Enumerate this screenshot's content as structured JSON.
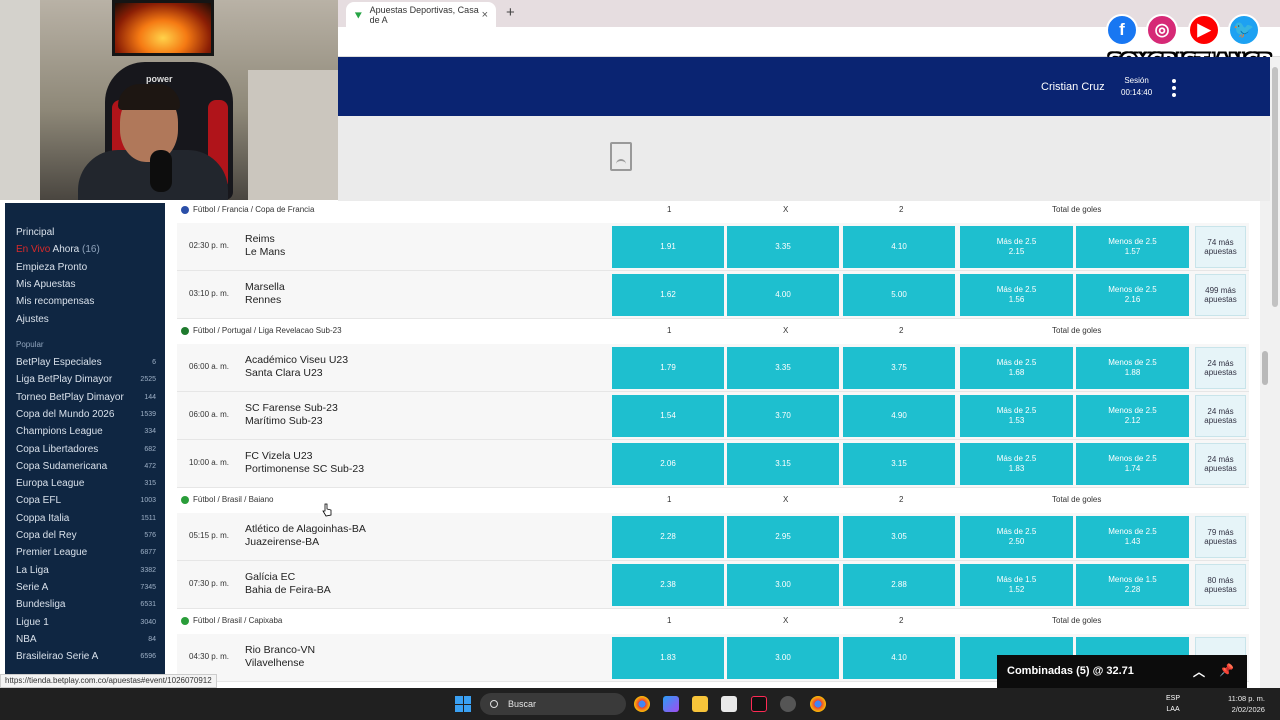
{
  "browser": {
    "tab_title": "Apuestas Deportivas, Casa de A",
    "tab_close": "×",
    "new_tab": "+"
  },
  "overlay": {
    "brand": "SOYCRISTIANCR",
    "social": [
      "f",
      "◎",
      "▶",
      "🐦"
    ],
    "chair_logo": "power"
  },
  "header": {
    "user_name": "Cristian Cruz",
    "session_label": "Sesión",
    "session_time": "00:14:40"
  },
  "sidebar": {
    "nav": [
      {
        "label": "Principal"
      },
      {
        "live": "En Vivo",
        "label": " Ahora",
        "count": " (16)"
      },
      {
        "label": "Empieza Pronto"
      },
      {
        "label": "Mis Apuestas"
      },
      {
        "label": "Mis recompensas"
      },
      {
        "label": "Ajustes"
      }
    ],
    "popular_label": "Popular",
    "leagues": [
      {
        "name": "BetPlay Especiales",
        "count": "6"
      },
      {
        "name": "Liga BetPlay Dimayor",
        "count": "2525"
      },
      {
        "name": "Torneo BetPlay Dimayor",
        "count": "144"
      },
      {
        "name": "Copa del Mundo 2026",
        "count": "1539"
      },
      {
        "name": "Champions League",
        "count": "334"
      },
      {
        "name": "Copa Libertadores",
        "count": "682"
      },
      {
        "name": "Copa Sudamericana",
        "count": "472"
      },
      {
        "name": "Europa League",
        "count": "315"
      },
      {
        "name": "Copa EFL",
        "count": "1003"
      },
      {
        "name": "Coppa Italia",
        "count": "1511"
      },
      {
        "name": "Copa del Rey",
        "count": "576"
      },
      {
        "name": "Premier League",
        "count": "6877"
      },
      {
        "name": "La Liga",
        "count": "3382"
      },
      {
        "name": "Serie A",
        "count": "7345"
      },
      {
        "name": "Bundesliga",
        "count": "6531"
      },
      {
        "name": "Ligue 1",
        "count": "3040"
      },
      {
        "name": "NBA",
        "count": "84"
      },
      {
        "name": "Brasileirao Serie A",
        "count": "6596"
      }
    ]
  },
  "columns": {
    "one": "1",
    "x": "X",
    "two": "2",
    "total": "Total de goles"
  },
  "groups": [
    {
      "path": "Fútbol / Francia / Copa de Francia",
      "flag_color": "#2b4fa8",
      "events": [
        {
          "time": "02:30 p. m.",
          "home": "Reims",
          "away": "Le Mans",
          "o1": "1.91",
          "ox": "3.35",
          "o2": "4.10",
          "over_label": "Más de  2.5",
          "over": "2.15",
          "under_label": "Menos de  2.5",
          "under": "1.57",
          "more": "74 más apuestas"
        },
        {
          "time": "03:10 p. m.",
          "home": "Marsella",
          "away": "Rennes",
          "o1": "1.62",
          "ox": "4.00",
          "o2": "5.00",
          "over_label": "Más de  2.5",
          "over": "1.56",
          "under_label": "Menos de  2.5",
          "under": "2.16",
          "more": "499 más apuestas"
        }
      ]
    },
    {
      "path": "Fútbol / Portugal / Liga Revelacao Sub-23",
      "flag_color": "#1f7a2e",
      "events": [
        {
          "time": "06:00 a. m.",
          "home": "Académico Viseu U23",
          "away": "Santa Clara U23",
          "o1": "1.79",
          "ox": "3.35",
          "o2": "3.75",
          "over_label": "Más de  2.5",
          "over": "1.68",
          "under_label": "Menos de  2.5",
          "under": "1.88",
          "more": "24 más apuestas"
        },
        {
          "time": "06:00 a. m.",
          "home": "SC Farense Sub-23",
          "away": "Marítimo Sub-23",
          "o1": "1.54",
          "ox": "3.70",
          "o2": "4.90",
          "over_label": "Más de  2.5",
          "over": "1.53",
          "under_label": "Menos de  2.5",
          "under": "2.12",
          "more": "24 más apuestas"
        },
        {
          "time": "10:00 a. m.",
          "home": "FC Vizela U23",
          "away": "Portimonense SC Sub-23",
          "o1": "2.06",
          "ox": "3.15",
          "o2": "3.15",
          "over_label": "Más de  2.5",
          "over": "1.83",
          "under_label": "Menos de  2.5",
          "under": "1.74",
          "more": "24 más apuestas"
        }
      ]
    },
    {
      "path": "Fútbol / Brasil / Baiano",
      "flag_color": "#2a9d3a",
      "events": [
        {
          "time": "05:15 p. m.",
          "home": "Atlético de Alagoinhas-BA",
          "away": "Juazeirense-BA",
          "o1": "2.28",
          "ox": "2.95",
          "o2": "3.05",
          "over_label": "Más de  2.5",
          "over": "2.50",
          "under_label": "Menos de  2.5",
          "under": "1.43",
          "more": "79 más apuestas"
        },
        {
          "time": "07:30 p. m.",
          "home": "Galícia EC",
          "away": "Bahia de Feira-BA",
          "o1": "2.38",
          "ox": "3.00",
          "o2": "2.88",
          "over_label": "Más de  1.5",
          "over": "1.52",
          "under_label": "Menos de  1.5",
          "under": "2.28",
          "more": "80 más apuestas"
        }
      ]
    },
    {
      "path": "Fútbol / Brasil / Capixaba",
      "flag_color": "#2a9d3a",
      "events": [
        {
          "time": "04:30 p. m.",
          "home": "Rio Branco-VN",
          "away": "Vilavelhense",
          "o1": "1.83",
          "ox": "3.00",
          "o2": "4.10",
          "over_label": "",
          "over": "",
          "under_label": "",
          "under": "",
          "more": ""
        }
      ]
    }
  ],
  "combo": {
    "label": "Combinadas (5) @ 32.71"
  },
  "status_url": "https://tienda.betplay.com.co/apuestas#event/1026070912",
  "taskbar": {
    "search": "Buscar",
    "lang1": "ESP",
    "lang2": "LAA",
    "time": "11:08 p. m.",
    "date": "2/02/2026"
  },
  "colors": {
    "header": "#0a2472",
    "odds": "#1ebfcf",
    "sidebar": "#0f2642"
  }
}
